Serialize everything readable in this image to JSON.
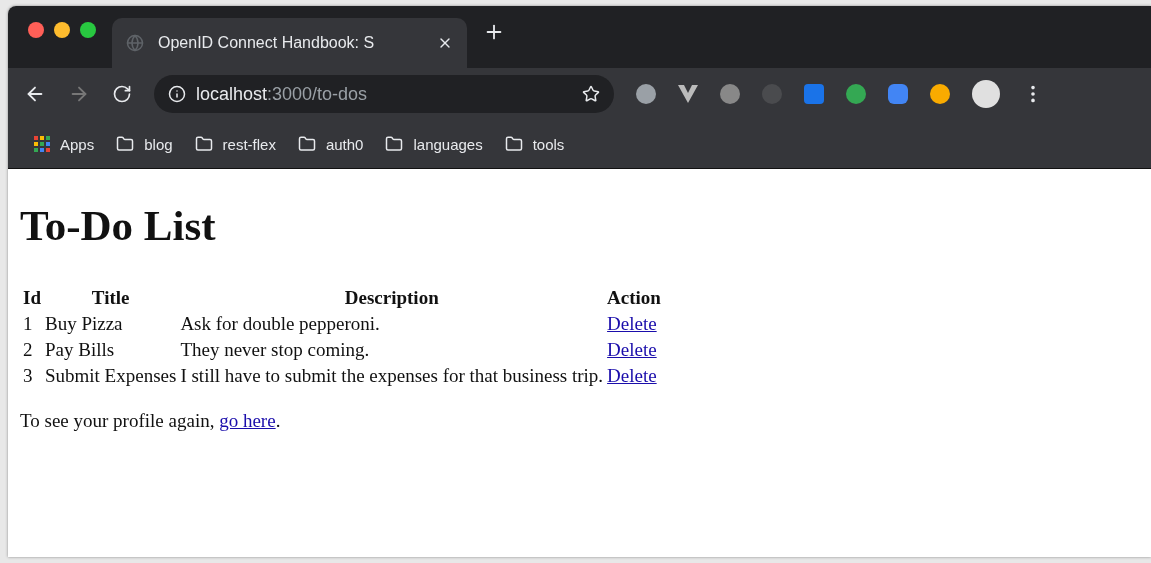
{
  "tab": {
    "title": "OpenID Connect Handbook: S",
    "selected": true
  },
  "address": {
    "host": "localhost",
    "path": ":3000/to-dos"
  },
  "bookmarks": [
    {
      "kind": "apps",
      "label": "Apps"
    },
    {
      "kind": "folder",
      "label": "blog"
    },
    {
      "kind": "folder",
      "label": "rest-flex"
    },
    {
      "kind": "folder",
      "label": "auth0"
    },
    {
      "kind": "folder",
      "label": "languages"
    },
    {
      "kind": "folder",
      "label": "tools"
    }
  ],
  "page": {
    "heading": "To-Do List",
    "table": {
      "columns": [
        "Id",
        "Title",
        "Description",
        "Action"
      ],
      "rows": [
        {
          "id": "1",
          "title": "Buy Pizza",
          "description": "Ask for double pepperoni.",
          "action": "Delete"
        },
        {
          "id": "2",
          "title": "Pay Bills",
          "description": "They never stop coming.",
          "action": "Delete"
        },
        {
          "id": "3",
          "title": "Submit Expenses",
          "description": "I still have to submit the expenses for that business trip.",
          "action": "Delete"
        }
      ]
    },
    "footer": {
      "text": "To see your profile again, ",
      "link": "go here",
      "after": "."
    }
  }
}
